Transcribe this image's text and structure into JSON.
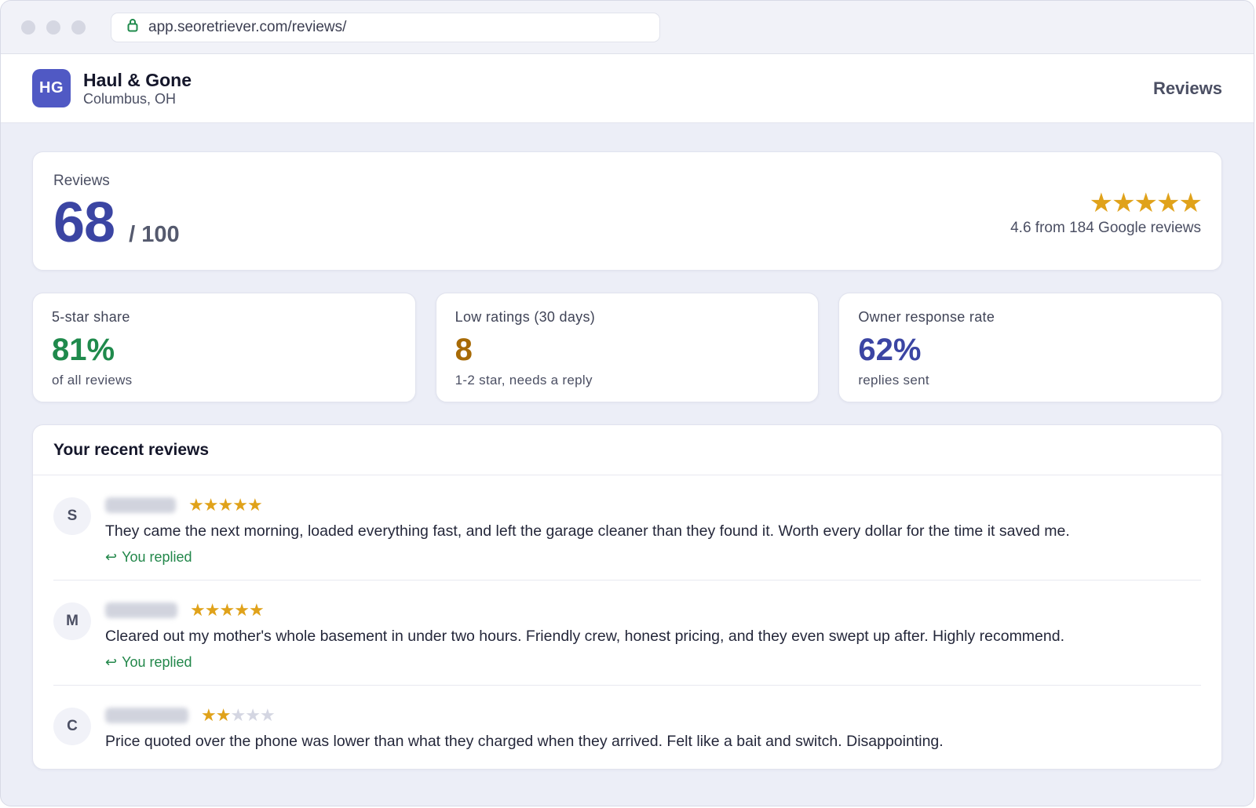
{
  "browser": {
    "url": "app.seoretriever.com/reviews/"
  },
  "header": {
    "logo_initials": "HG",
    "business_name": "Haul & Gone",
    "location": "Columbus, OH",
    "nav_label": "Reviews"
  },
  "score": {
    "label": "Reviews",
    "value": "68",
    "max": "/ 100",
    "stars": 5,
    "rating_text": "4.6 from 184 Google reviews"
  },
  "stats": [
    {
      "label": "5-star share",
      "value": "81%",
      "sub": "of all reviews",
      "color": "#1f8a4c"
    },
    {
      "label": "Low ratings (30 days)",
      "value": "8",
      "sub": "1-2 star, needs a reply",
      "color": "#a76a06"
    },
    {
      "label": "Owner response rate",
      "value": "62%",
      "sub": "replies sent",
      "color": "#3b45a3"
    }
  ],
  "recent": {
    "title": "Your recent reviews",
    "reviews": [
      {
        "initial": "S",
        "rating": 5,
        "text": "They came the next morning, loaded everything fast, and left the garage cleaner than they found it. Worth every dollar for the time it saved me.",
        "replied": "You replied"
      },
      {
        "initial": "M",
        "rating": 5,
        "text": "Cleared out my mother's whole basement in under two hours. Friendly crew, honest pricing, and they even swept up after. Highly recommend.",
        "replied": "You replied"
      },
      {
        "initial": "C",
        "rating": 2,
        "text": "Price quoted over the phone was lower than what they charged when they arrived. Felt like a bait and switch. Disappointing.",
        "replied": ""
      }
    ]
  },
  "colors": {
    "accent": "#3b45a3",
    "star": "#e0a21a",
    "star_empty": "#d4d6e2",
    "success": "#22874a"
  }
}
